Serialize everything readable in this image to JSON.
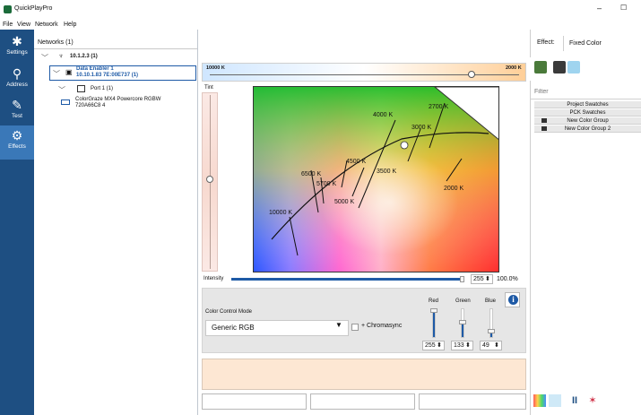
{
  "window": {
    "app_icon": "quickplay-logo-icon",
    "title": "QuickPlayPro",
    "minimize_glyph": "–",
    "maximize_glyph": "☐"
  },
  "menu": [
    "File",
    "View",
    "Network",
    "Help"
  ],
  "nav": [
    {
      "label": "Settings",
      "icon": "gear-icon",
      "glyph": "✱"
    },
    {
      "label": "Address",
      "icon": "location-pin-icon",
      "glyph": "⚲"
    },
    {
      "label": "Test",
      "icon": "wrench-icon",
      "glyph": "✎"
    },
    {
      "label": "Effects",
      "icon": "effects-icon",
      "glyph": "⚙"
    }
  ],
  "tree": {
    "header": "Networks (1)",
    "network": "10.1.2.3 (1)",
    "enabler_name": "Data Enabler 1",
    "enabler_address": "10.10.1.83 7E:00E737 (1)",
    "port": "Port 1 (1)",
    "fixture_name": "ColorGraze MX4 Powercore RGBW",
    "fixture_serial": "720A66C8 4"
  },
  "cct": {
    "low_label": "10000 K",
    "high_label": "2000 K"
  },
  "tint_label": "Tint",
  "cie_labels": [
    "2700 K",
    "4000 K",
    "3000 K",
    "4500 K",
    "3500 K",
    "6500 K",
    "5700 K",
    "5000 K",
    "2000 K",
    "10000 K"
  ],
  "intensity": {
    "label": "Intensity",
    "value": "255",
    "percent": "100.0%",
    "level": 1.0
  },
  "control": {
    "mode_label": "Color Control Mode",
    "mode_value": "Generic RGB",
    "chromasync_label": "+ Chromasync",
    "channels": [
      {
        "name": "Red",
        "value": "255",
        "level": 1.0
      },
      {
        "name": "Green",
        "value": "133",
        "level": 0.52
      },
      {
        "name": "Blue",
        "value": "49",
        "level": 0.19
      }
    ],
    "info_icon": "info-icon",
    "info_glyph": "i"
  },
  "preview_color": "#fde7d3",
  "effect": {
    "label": "Effect:",
    "value": "Fixed Color"
  },
  "swatches": {
    "filter_placeholder": "Filter",
    "groups": [
      "Project Swatches",
      "PCK Swatches",
      "New Color Group",
      "New Color Group 2"
    ]
  },
  "colors": {
    "nav_bg": "#1e4f82",
    "nav_active": "#3a78b8",
    "slider_fill": "#1e5aa6",
    "preview": "#fde7d3"
  }
}
